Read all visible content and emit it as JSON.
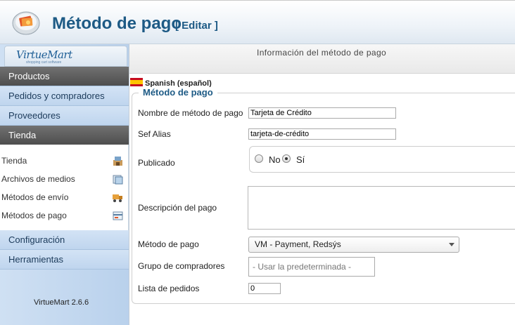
{
  "header": {
    "title": "Método de pago",
    "edit_tag": "[ Editar ]"
  },
  "sidebar": {
    "logo_text": "VirtueMart",
    "logo_subtext": "shopping cart software",
    "items": [
      {
        "label": "Productos"
      },
      {
        "label": "Pedidos y compradores"
      },
      {
        "label": "Proveedores"
      },
      {
        "label": "Tienda"
      },
      {
        "label": "Configuración"
      },
      {
        "label": "Herramientas"
      }
    ],
    "submenu": [
      {
        "label": "Tienda",
        "icon": "store-icon"
      },
      {
        "label": "Archivos de medios",
        "icon": "media-files-icon"
      },
      {
        "label": "Métodos de envío",
        "icon": "truck-icon"
      },
      {
        "label": "Métodos de pago",
        "icon": "payment-icon"
      }
    ],
    "version": "VirtueMart 2.6.6"
  },
  "main": {
    "info_title": "Información del método de pago",
    "language_label": "Spanish (español)",
    "legend": "Método de pago",
    "fields": {
      "name_label": "Nombre de método de pago",
      "name_value": "Tarjeta de Crédito",
      "alias_label": "Sef Alias",
      "alias_value": "tarjeta-de-crédito",
      "published_label": "Publicado",
      "published_no": "No",
      "published_yes": "Sí",
      "published_selected": "Sí",
      "description_label": "Descripción del pago",
      "method_label": "Método de pago",
      "method_value": "VM - Payment, Redsýs",
      "group_label": "Grupo de compradores",
      "group_value": "- Usar la predeterminada -",
      "orders_label": "Lista de pedidos",
      "orders_value": "0"
    }
  },
  "colors": {
    "title_blue": "#1d5a85",
    "nav_dark": "#5a5a5a",
    "nav_blue": "#c8dbf1"
  }
}
